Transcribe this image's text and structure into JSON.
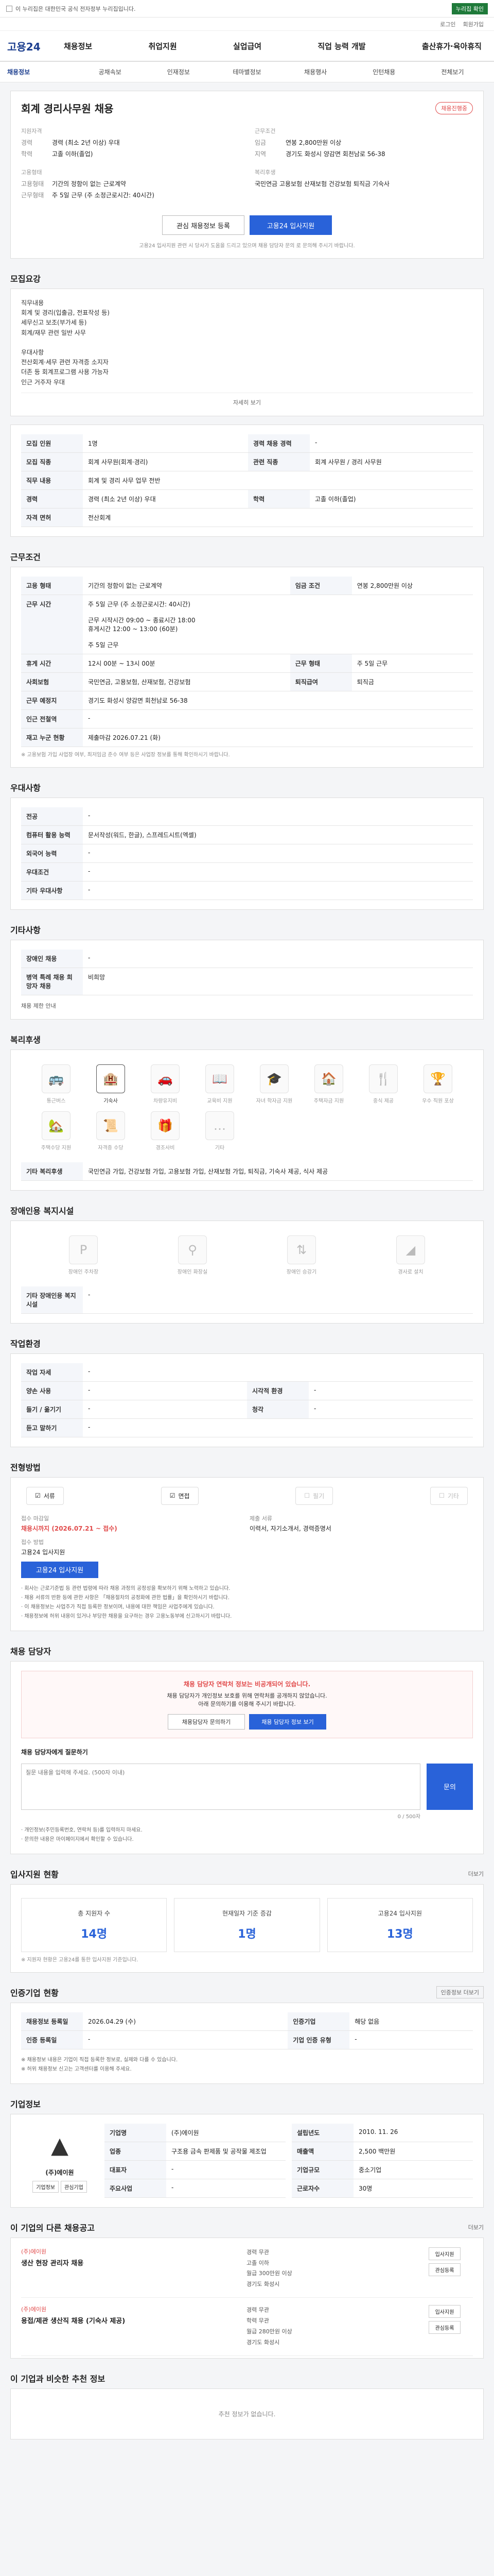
{
  "topbar": {
    "notice": "이 누리집은 대한민국 공식 전자정부 누리집입니다.",
    "button": "누리집 확인"
  },
  "util": {
    "login": "로그인",
    "join": "회원가입"
  },
  "header": {
    "logo": "고용24",
    "menu": [
      "채용정보",
      "취업지원",
      "실업급여",
      "직업 능력 개발",
      "출산휴가·육아휴직"
    ]
  },
  "lnb": {
    "items": [
      "채용정보",
      "공채속보",
      "인재정보",
      "테마별정보",
      "채용행사",
      "인턴채용",
      "전체보기"
    ]
  },
  "job": {
    "title": "회계 경리사무원 채용",
    "badge": "채용진행중",
    "apply": {
      "label": "지원자격",
      "career_k": "경력",
      "career_v": "경력 (최소 2년 이상) 우대",
      "edu_k": "학력",
      "edu_v": "고졸 이하(졸업)"
    },
    "cond": {
      "label": "근무조건",
      "wage_k": "임금",
      "wage_v": "연봉 2,800만원 이상",
      "area_k": "지역",
      "area_v": "경기도 화성시 양감면 회천남로 56-38"
    },
    "type": {
      "label": "고용형태",
      "type_k": "고용형태",
      "type_v": "기간의 정함이 없는 근로계약",
      "time_k": "근무형태",
      "time_v": "주 5일 근무 (주 소정근로시간: 40시간)"
    },
    "welfare": {
      "label": "복리후생",
      "v": "국민연금 고용보험 산재보험 건강보험 퇴직금 기숙사"
    },
    "buttons": {
      "scrap": "관심 채용정보 등록",
      "apply": "고용24 입사지원"
    },
    "note": "고용24 입사지원 관련 시 당사가 도움을 드리고 있으며 채용 담당자 문의 로 문의해 주시기 바랍니다."
  },
  "recruit": {
    "title": "모집요강",
    "text": "직무내용\n회계 및 경리(입출금, 전표작성 등)\n세무신고 보조(부가세 등)\n회계/재무 관련 일반 사무\n\n우대사항\n전산회계·세무 관련 자격증 소지자\n더존 등 회계프로그램 사용 가능자\n인근 거주자 우대",
    "more": "자세히 보기"
  },
  "detail": {
    "rows": [
      {
        "k": "모집 인원",
        "v": "1명",
        "k2": "경력 채용 경력",
        "v2": "-"
      },
      {
        "k": "모집 직종",
        "v": "회계 사무원(회계·경리)",
        "k2": "관련 직종",
        "v2": "회계 사무원 / 경리 사무원"
      },
      {
        "k": "직무 내용",
        "v": "회계 및 경리 사무 업무 전반",
        "k2": "",
        "v2": ""
      },
      {
        "k": "경력",
        "v": "경력 (최소 2년 이상) 우대",
        "k2": "학력",
        "v2": "고졸 이하(졸업)"
      },
      {
        "k": "자격 면허",
        "v": "전산회계",
        "k2": "",
        "v2": ""
      }
    ]
  },
  "conditions": {
    "title": "근무조건",
    "rows": [
      {
        "k": "고용 형태",
        "v": "기간의 정함이 없는 근로계약",
        "k2": "임금 조건",
        "v2": "연봉 2,800만원 이상"
      },
      {
        "k": "근무 시간",
        "v": "주 5일 근무 (주 소정근로시간: 40시간)\n\n근무 시작시간 09:00 ~ 종료시간 18:00\n휴게시간 12:00 ~ 13:00 (60분)\n\n주 5일 근무"
      },
      {
        "k": "휴게 시간",
        "v": "12시 00분 ~ 13시 00분",
        "k2": "근무 형태",
        "v2": "주 5일 근무"
      },
      {
        "k": "사회보험",
        "v": "국민연금, 고용보험, 산재보험, 건강보험",
        "k2": "퇴직급여",
        "v2": "퇴직금"
      },
      {
        "k": "근무 예정지",
        "v": "경기도 화성시 양감면 회천남로 56-38",
        "k2": "",
        "v2": ""
      },
      {
        "k": "인근 전철역",
        "v": "-",
        "k2": "",
        "v2": ""
      },
      {
        "k": "재고 누군 현황",
        "v": "제출마감 2026.07.21 (화)",
        "k2": "",
        "v2": ""
      }
    ],
    "note": "※ 고용보험 가입 사업장 여부, 최저임금 준수 여부 등은 사업장 정보를 통해 확인하시기 바랍니다."
  },
  "prefer": {
    "title": "우대사항",
    "rows": [
      {
        "k": "전공",
        "v": "-"
      },
      {
        "k": "컴퓨터 활용 능력",
        "v": "문서작성(워드, 한글), 스프레드시트(엑셀)"
      },
      {
        "k": "외국어 능력",
        "v": "-"
      },
      {
        "k": "우대조건",
        "v": "-"
      },
      {
        "k": "기타 우대사항",
        "v": "-"
      }
    ]
  },
  "etc": {
    "title": "기타사항",
    "rows": [
      {
        "k": "장애인 채용",
        "v": "-"
      },
      {
        "k": "병역 특례 채용 희망자 채용",
        "v": "비희망"
      }
    ],
    "link": "채용 제한 안내"
  },
  "welfare": {
    "title": "복리후생",
    "items": [
      {
        "label": "통근버스",
        "on": false,
        "icon": "bus-icon"
      },
      {
        "label": "기숙사",
        "on": true,
        "icon": "dormitory-icon"
      },
      {
        "label": "차량유지비",
        "on": false,
        "icon": "car-icon"
      },
      {
        "label": "교육비 지원",
        "on": false,
        "icon": "education-icon"
      },
      {
        "label": "자녀 학자금 지원",
        "on": false,
        "icon": "scholarship-icon"
      },
      {
        "label": "주택자금 지원",
        "on": false,
        "icon": "house-icon"
      },
      {
        "label": "중식 제공",
        "on": false,
        "icon": "meal-icon"
      },
      {
        "label": "우수 직원 포상",
        "on": false,
        "icon": "award-icon"
      },
      {
        "label": "주택수당 지원",
        "on": false,
        "icon": "home-icon"
      },
      {
        "label": "자격증 수당",
        "on": false,
        "icon": "license-icon"
      },
      {
        "label": "경조사비",
        "on": false,
        "icon": "gift-icon"
      },
      {
        "label": "기타",
        "on": false,
        "icon": "etc-icon"
      }
    ],
    "extra_k": "기타 복리후생",
    "extra_v": "국민연금 가입, 건강보험 가입, 고용보험 가입, 산재보험 가입, 퇴직금, 기숙사 제공, 식사 제공"
  },
  "disability": {
    "title": "장애인용 복지시설",
    "items": [
      {
        "label": "장애인 주차장",
        "icon": "parking-icon"
      },
      {
        "label": "장애인 화장실",
        "icon": "toilet-icon"
      },
      {
        "label": "장애인 승강기",
        "icon": "elevator-icon"
      },
      {
        "label": "경사로 설치",
        "icon": "ramp-icon"
      }
    ],
    "extra_k": "기타 장애인용 복지시설",
    "extra_v": "-"
  },
  "workplace": {
    "title": "작업환경",
    "rows": [
      {
        "k": "작업 자세",
        "v": "-",
        "k2": "",
        "v2": ""
      },
      {
        "k": "양손 사용",
        "v": "-",
        "k2": "시각적 환경",
        "v2": "-"
      },
      {
        "k": "들기 / 옮기기",
        "v": "-",
        "k2": "청각",
        "v2": "-"
      },
      {
        "k": "듣고 말하기",
        "v": "-",
        "k2": "",
        "v2": ""
      }
    ]
  },
  "application": {
    "title": "전형방법",
    "methods": [
      {
        "label": "서류",
        "on": true
      },
      {
        "label": "면접",
        "on": true
      },
      {
        "label": "필기",
        "on": false
      },
      {
        "label": "기타",
        "on": false
      }
    ],
    "period_k": "접수 마감일",
    "period_v": "채용시까지 (2026.07.21 ~ 접수)",
    "period_red": "채용시까지 (2026.07.21 ~ 접수)",
    "way_k": "접수 방법",
    "way_v": "고용24 입사지원",
    "docs_k": "제출 서류",
    "docs_v": "이력서, 자기소개서, 경력증명서",
    "apply_btn": "고용24 입사지원",
    "notes": [
      "· 회사는 근로기준법 등 관련 법령에 따라 채용 과정의 공정성을 확보하기 위해 노력하고 있습니다.",
      "· 채용 서류의 반환 등에 관한 사항은 「채용절차의 공정화에 관한 법률」을 확인하시기 바랍니다.",
      "· 이 채용정보는 사업주가 직접 등록한 정보이며, 내용에 대한 책임은 사업주에게 있습니다.",
      "· 채용정보에 허위 내용이 있거나 부당한 채용을 요구하는 경우 고용노동부에 신고하시기 바랍니다."
    ]
  },
  "contact": {
    "title": "채용 담당자",
    "alert_title": "채용 담당자 연락처 정보는 비공개되어 있습니다.",
    "alert_body": "채용 담당자가 개인정보 보호를 위해 연락처를 공개하지 않았습니다.\n아래 문의하기를 이용해 주시기 바랍니다.",
    "btn1": "채용담당자 문의하기",
    "btn2": "채용 담당자 정보 보기",
    "q_label": "채용 담당자에게 질문하기",
    "q_placeholder": "질문 내용을 입력해 주세요. (500자 이내)",
    "q_btn": "문의",
    "q_count": "0 / 500자",
    "q_notes": [
      "· 개인정보(주민등록번호, 연락처 등)를 입력하지 마세요.",
      "· 문의한 내용은 마이페이지에서 확인할 수 있습니다."
    ]
  },
  "stats": {
    "title": "입사지원 현황",
    "more": "더보기",
    "items": [
      {
        "k": "총 지원자 수",
        "v": "14명"
      },
      {
        "k": "현재일자 기준 증감",
        "v": "1명"
      },
      {
        "k": "고용24 입사지원",
        "v": "13명"
      }
    ],
    "note": "※ 지원자 현황은 고용24를 통한 입사지원 기준입니다."
  },
  "reg": {
    "title": "인증기업 현황",
    "more": "인증정보 더보기",
    "rows": [
      {
        "k": "채용정보 등록일",
        "v": "2026.04.29 (수)",
        "k2": "인증기업",
        "v2": "해당 없음"
      },
      {
        "k": "인증 등록일",
        "v": "-",
        "k2": "기업 인증 유형",
        "v2": "-"
      }
    ],
    "notes": [
      "※ 채용정보 내용은 기업이 직접 등록한 정보로, 실제와 다를 수 있습니다.",
      "※ 허위 채용정보 신고는 고객센터를 이용해 주세요."
    ]
  },
  "company": {
    "title": "기업정보",
    "name": "(주)에이원",
    "btn1": "기업정보",
    "btn2": "관심기업",
    "rows": [
      {
        "k": "기업명",
        "v": "(주)에이원"
      },
      {
        "k": "업종",
        "v": "구조용 금속 판제품 및 공작물 제조업"
      },
      {
        "k": "대표자",
        "v": "-"
      },
      {
        "k": "주요사업",
        "v": "-"
      }
    ],
    "rows2": [
      {
        "k": "설립년도",
        "v": "2010. 11. 26"
      },
      {
        "k": "매출액",
        "v": "2,500 백만원"
      },
      {
        "k": "기업규모",
        "v": "중소기업"
      },
      {
        "k": "근로자수",
        "v": "30명"
      }
    ]
  },
  "others": {
    "title": "이 기업의 다른 채용공고",
    "more": "더보기",
    "jobs": [
      {
        "co": "(주)에이원",
        "title": "생산 현장 관리자 채용",
        "meta": [
          "경력 무관",
          "고졸 이하",
          "월급 300만원 이상",
          "경기도 화성시"
        ],
        "btn1": "입사지원",
        "btn2": "관심등록"
      },
      {
        "co": "(주)에이원",
        "title": "용접/제관 생산직 채용 (기숙사 제공)",
        "meta": [
          "경력 무관",
          "학력 무관",
          "월급 280만원 이상",
          "경기도 화성시"
        ],
        "btn1": "입사지원",
        "btn2": "관심등록"
      }
    ]
  },
  "related": {
    "title": "이 기업과 비슷한 추천 정보",
    "empty": "추천 정보가 없습니다."
  }
}
